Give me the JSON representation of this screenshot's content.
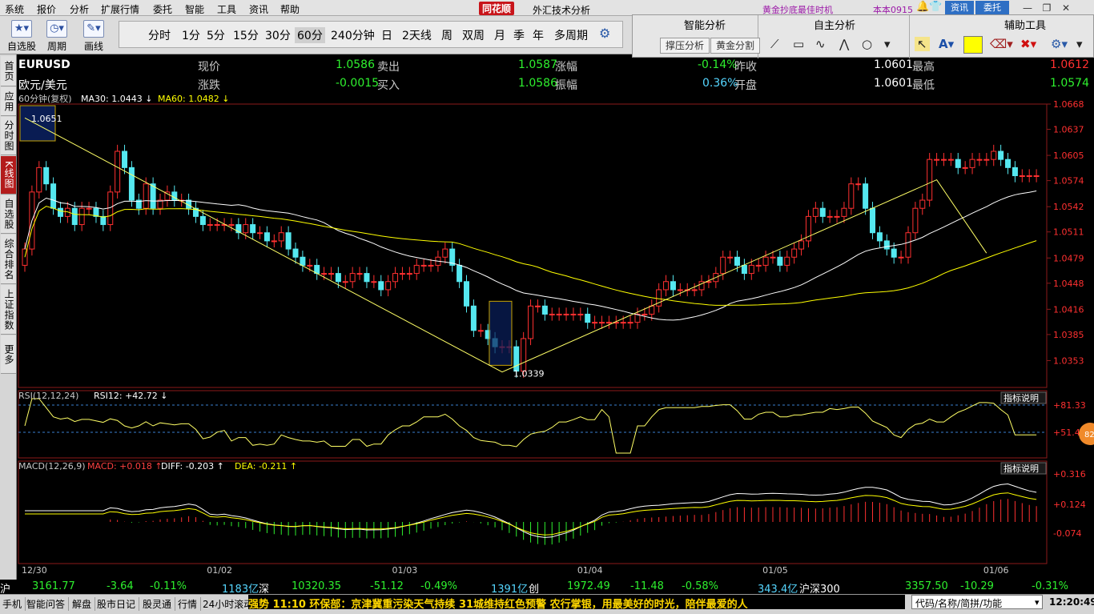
{
  "menu": [
    "系统",
    "报价",
    "分析",
    "扩展行情",
    "委托",
    "智能",
    "工具",
    "资讯",
    "帮助"
  ],
  "logo": "同花顺",
  "app_title": "外汇技术分析",
  "promo": "黄金抄底最佳时机",
  "version": "本本0915",
  "news_btn": "资讯",
  "entrust_btn": "委托",
  "window_controls": [
    "—",
    "❐",
    "✕"
  ],
  "toolbar": {
    "tools": [
      {
        "label": "自选股",
        "icon": "star-icon"
      },
      {
        "label": "周期",
        "icon": "clock-icon"
      },
      {
        "label": "画线",
        "icon": "pencil-icon"
      }
    ],
    "periods": [
      "分时",
      "1分",
      "5分",
      "15分",
      "30分",
      "60分",
      "240分钟",
      "日",
      "2天线",
      "周",
      "双周",
      "月",
      "季",
      "年",
      "多周期"
    ],
    "active_period": "60分"
  },
  "right_panel": {
    "heads": [
      "智能分析",
      "自主分析",
      "辅助工具"
    ],
    "buttons": [
      "撑压分析",
      "黄金分割"
    ],
    "tool_icons": [
      "line-tool-icon",
      "rect-tool-icon",
      "wave-tool-icon",
      "zigzag-tool-icon",
      "circle-tool-icon",
      "cursor-icon",
      "text-tool-icon",
      "color-icon",
      "eraser-icon",
      "delete-icon",
      "gear-icon",
      "more-icon"
    ]
  },
  "left_tabs": [
    "首页",
    "应用",
    "分时图",
    "K线图",
    "自选股",
    "综合排名",
    "上证指数",
    "更多"
  ],
  "active_tab": "K线图",
  "quote": {
    "code": "EURUSD",
    "name": "欧元/美元",
    "rows": [
      [
        {
          "label": "现价",
          "value": "1.0586",
          "vcolor": "#2ef02e"
        },
        {
          "label": "卖出",
          "value": "1.0587",
          "vcolor": "#2ef02e"
        },
        {
          "label": "涨幅",
          "value": "-0.14%",
          "vcolor": "#2ef02e"
        },
        {
          "label": "昨收",
          "value": "1.0601",
          "vcolor": "#ffffff"
        },
        {
          "label": "最高",
          "value": "1.0612",
          "vcolor": "#ff3030"
        }
      ],
      [
        {
          "label": "涨跌",
          "value": "-0.0015",
          "vcolor": "#2ef02e"
        },
        {
          "label": "买入",
          "value": "1.0586",
          "vcolor": "#2ef02e"
        },
        {
          "label": "振幅",
          "value": "0.36%",
          "vcolor": "#55d6ff"
        },
        {
          "label": "开盘",
          "value": "1.0601",
          "vcolor": "#ffffff"
        },
        {
          "label": "最低",
          "value": "1.0574",
          "vcolor": "#2ef02e"
        }
      ]
    ]
  },
  "chart_data": [
    {
      "type": "candlestick",
      "title": "60分钟(复权)",
      "legend": [
        {
          "name": "MA30: 1.0443",
          "color": "#ffffff",
          "arrow": "down"
        },
        {
          "name": "MA60: 1.0482",
          "color": "#ffff00",
          "arrow": "down"
        }
      ],
      "ylim": [
        1.032,
        1.0668
      ],
      "y_ticks": [
        "1.0668",
        "1.0637",
        "1.0605",
        "1.0574",
        "1.0542",
        "1.0511",
        "1.0479",
        "1.0448",
        "1.0416",
        "1.0385",
        "1.0353"
      ],
      "x_ticks": [
        "12/30",
        "01/02",
        "01/03",
        "01/04",
        "01/05",
        "01/06"
      ],
      "markers": [
        {
          "label": "1.0651"
        },
        {
          "label": "1.0339"
        }
      ],
      "close_values": [
        1.049,
        1.056,
        1.059,
        1.057,
        1.054,
        1.053,
        1.054,
        1.052,
        1.054,
        1.054,
        1.053,
        1.052,
        1.056,
        1.061,
        1.059,
        1.055,
        1.054,
        1.057,
        1.054,
        1.055,
        1.056,
        1.055,
        1.055,
        1.054,
        1.053,
        1.052,
        1.052,
        1.052,
        1.052,
        1.052,
        1.051,
        1.052,
        1.051,
        1.051,
        1.05,
        1.05,
        1.051,
        1.049,
        1.048,
        1.047,
        1.047,
        1.046,
        1.046,
        1.046,
        1.045,
        1.045,
        1.046,
        1.046,
        1.045,
        1.045,
        1.044,
        1.045,
        1.046,
        1.046,
        1.046,
        1.047,
        1.047,
        1.047,
        1.048,
        1.049,
        1.047,
        1.045,
        1.042,
        1.039,
        1.039,
        1.038,
        1.037,
        1.037,
        1.037,
        1.034,
        1.038,
        1.042,
        1.042,
        1.041,
        1.041,
        1.041,
        1.041,
        1.041,
        1.041,
        1.04,
        1.04,
        1.04,
        1.04,
        1.04,
        1.04,
        1.04,
        1.041,
        1.041,
        1.042,
        1.044,
        1.045,
        1.044,
        1.044,
        1.044,
        1.044,
        1.045,
        1.045,
        1.046,
        1.048,
        1.048,
        1.047,
        1.046,
        1.047,
        1.047,
        1.048,
        1.048,
        1.047,
        1.048,
        1.049,
        1.05,
        1.053,
        1.054,
        1.053,
        1.053,
        1.053,
        1.054,
        1.057,
        1.057,
        1.054,
        1.051,
        1.05,
        1.049,
        1.048,
        1.048,
        1.051,
        1.054,
        1.055,
        1.06,
        1.06,
        1.06,
        1.06,
        1.059,
        1.059,
        1.06,
        1.06,
        1.06,
        1.061,
        1.06,
        1.059,
        1.058,
        1.058,
        1.058,
        1.058
      ]
    },
    {
      "type": "line",
      "title": "RSI(12,12,24)",
      "legend": [
        {
          "name": "RSI12: +42.72",
          "color": "#ffffff",
          "arrow": "down"
        }
      ],
      "y_ticks": [
        "+81.33",
        "+51.48"
      ],
      "button": "指标说明",
      "badge": "82"
    },
    {
      "type": "line",
      "title": "MACD(12,26,9)",
      "legend": [
        {
          "name": "MACD: +0.018",
          "color": "#ff4040",
          "arrow": "up"
        },
        {
          "name": "DIFF: -0.203",
          "color": "#ffffff",
          "arrow": "up"
        },
        {
          "name": "DEA: -0.211",
          "color": "#ffff00",
          "arrow": "up"
        }
      ],
      "y_ticks": [
        "+0.316",
        "+0.124",
        "-0.074"
      ],
      "button": "指标说明"
    }
  ],
  "status": [
    {
      "text": "沪",
      "color": "#ffffff"
    },
    {
      "text": "3161.77",
      "color": "#2ef02e"
    },
    {
      "text": "-3.64",
      "color": "#2ef02e"
    },
    {
      "text": "-0.11%",
      "color": "#2ef02e"
    },
    {
      "text": "1183亿",
      "color": "#55d6ff"
    },
    {
      "text": "深",
      "color": "#ffffff"
    },
    {
      "text": "10320.35",
      "color": "#2ef02e"
    },
    {
      "text": "-51.12",
      "color": "#2ef02e"
    },
    {
      "text": "-0.49%",
      "color": "#2ef02e"
    },
    {
      "text": "1391亿",
      "color": "#55d6ff"
    },
    {
      "text": "创",
      "color": "#ffffff"
    },
    {
      "text": "1972.49",
      "color": "#2ef02e"
    },
    {
      "text": "-11.48",
      "color": "#2ef02e"
    },
    {
      "text": "-0.58%",
      "color": "#2ef02e"
    },
    {
      "text": "343.4亿",
      "color": "#55d6ff"
    },
    {
      "text": "沪深300",
      "color": "#ffffff"
    },
    {
      "text": "3357.50",
      "color": "#2ef02e"
    },
    {
      "text": "-10.29",
      "color": "#2ef02e"
    },
    {
      "text": "-0.31%",
      "color": "#2ef02e"
    }
  ],
  "taskbar": {
    "items": [
      "手机",
      "智能问答",
      "解盘",
      "股市日记",
      "股灵通",
      "行情",
      "24小时滚动"
    ],
    "ticker": "强势          11:10 环保部：京津冀重污染天气持续 31城维持红色预警                      农行掌银，用最美好的时光，陪伴最爱的人",
    "search_placeholder": "代码/名称/简拼/功能",
    "clock": "12:20:49"
  }
}
